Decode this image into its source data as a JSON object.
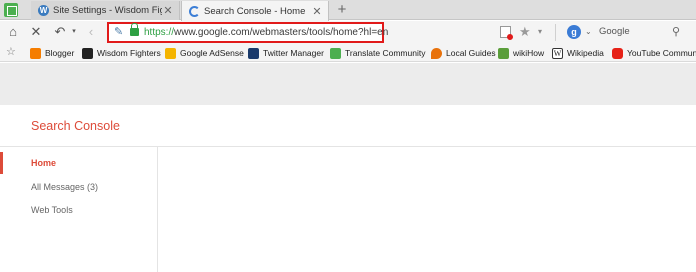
{
  "tabs": [
    {
      "title": "Site Settings - Wisdom Fighters",
      "active": false,
      "favicon": "wordpress-icon"
    },
    {
      "title": "Search Console - Home",
      "active": true,
      "favicon": "loading-icon"
    }
  ],
  "toolbar": {
    "url_protocol": "https://",
    "url_rest": "www.google.com/webmasters/tools/home?hl=en",
    "search_engine_letter": "g",
    "search_placeholder": "Google",
    "highlight_color": "#e11a1a"
  },
  "bookmarks": [
    {
      "label": "Blogger",
      "icon": "blogger-icon",
      "color": "#f57d00"
    },
    {
      "label": "Wisdom Fighters",
      "icon": "wisdom-fighters-icon",
      "color": "#222222"
    },
    {
      "label": "Google AdSense",
      "icon": "adsense-icon",
      "color": "#f4b400"
    },
    {
      "label": "Twitter Manager",
      "icon": "twitter-manager-icon",
      "color": "#1a3a6b"
    },
    {
      "label": "Translate Community",
      "icon": "translate-icon",
      "color": "#4caf50"
    },
    {
      "label": "Local Guides",
      "icon": "local-guides-icon",
      "color": "#e8710a"
    },
    {
      "label": "wikiHow",
      "icon": "wikihow-icon",
      "color": "#5a9e3a"
    },
    {
      "label": "Wikipedia",
      "icon": "wikipedia-icon",
      "color": "#333333"
    },
    {
      "label": "YouTube Community",
      "icon": "youtube-icon",
      "color": "#e62117"
    }
  ],
  "page": {
    "brand": "Search Console",
    "brand_color": "#dd4b39",
    "nav": [
      {
        "label": "Home",
        "active": true
      },
      {
        "label": "All Messages (3)",
        "active": false
      },
      {
        "label": "Web Tools",
        "active": false
      }
    ]
  }
}
